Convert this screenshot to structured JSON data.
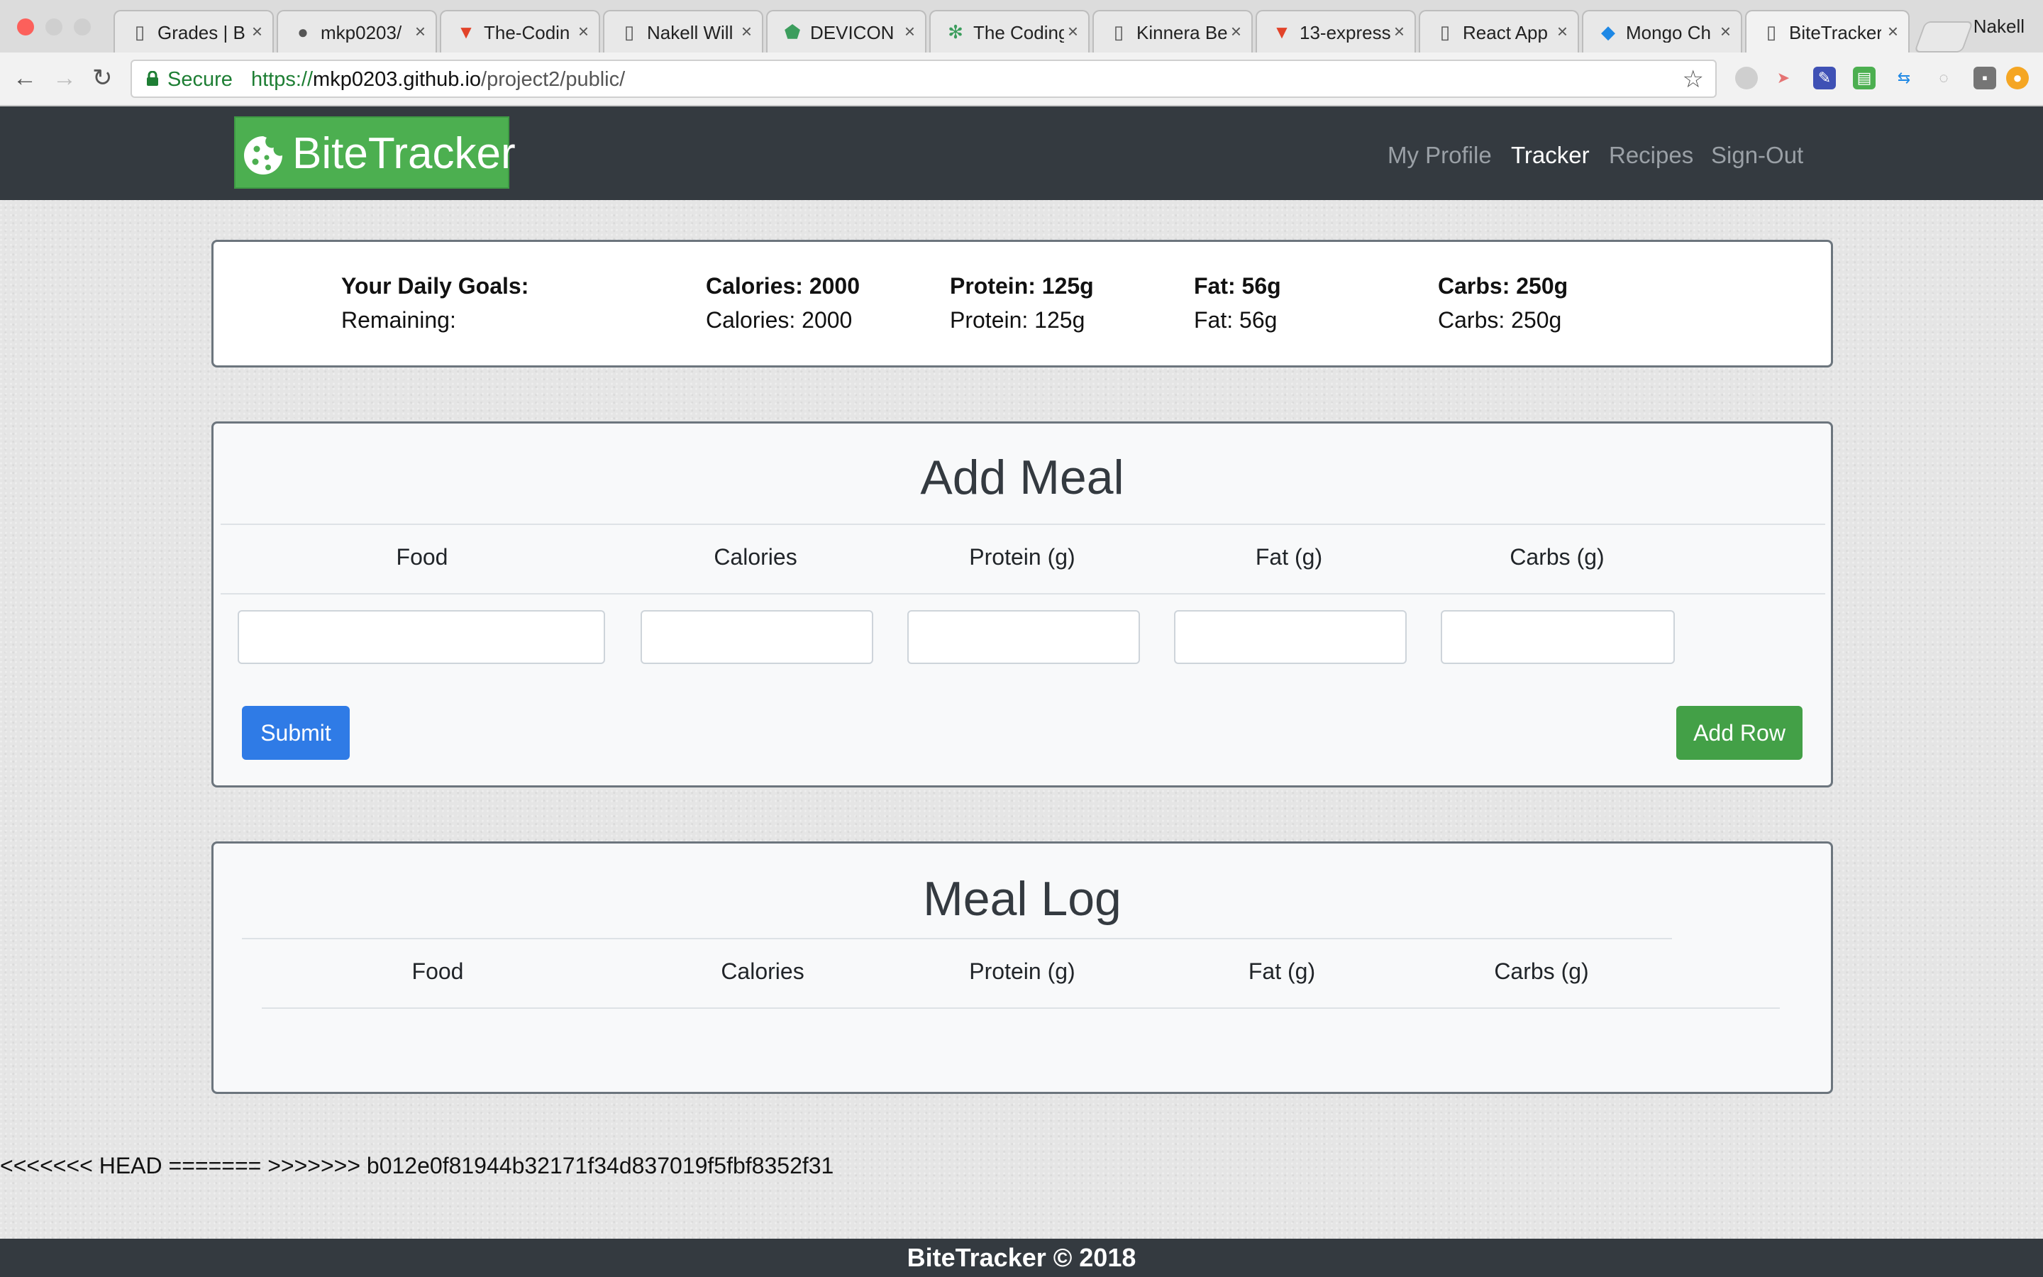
{
  "browser": {
    "tabs": [
      {
        "title": "Grades | B",
        "icon": "page-icon"
      },
      {
        "title": "mkp0203/",
        "icon": "github-icon"
      },
      {
        "title": "The-Codin",
        "icon": "gitlab-icon"
      },
      {
        "title": "Nakell Will",
        "icon": "page-icon"
      },
      {
        "title": "DEVICON",
        "icon": "devicon-icon"
      },
      {
        "title": "The Coding",
        "icon": "plant-icon"
      },
      {
        "title": "Kinnera Be",
        "icon": "page-icon"
      },
      {
        "title": "13-express",
        "icon": "gitlab-icon"
      },
      {
        "title": "React App",
        "icon": "page-icon"
      },
      {
        "title": "Mongo Ch",
        "icon": "mongo-icon"
      },
      {
        "title": "BiteTracker",
        "icon": "page-icon"
      }
    ],
    "profile_name": "Nakell",
    "secure_label": "Secure",
    "url_scheme": "https://",
    "url_host": "mkp0203.github.io",
    "url_path": "/project2/public/"
  },
  "nav": {
    "brand": "BiteTracker",
    "links": [
      "My Profile",
      "Tracker",
      "Recipes",
      "Sign-Out"
    ],
    "active": "Tracker"
  },
  "goals": {
    "daily_label": "Your Daily Goals:",
    "remaining_label": "Remaining:",
    "daily": {
      "calories": "Calories: 2000",
      "protein": "Protein: 125g",
      "fat": "Fat: 56g",
      "carbs": "Carbs: 250g"
    },
    "remaining": {
      "calories": "Calories: 2000",
      "protein": "Protein: 125g",
      "fat": "Fat: 56g",
      "carbs": "Carbs: 250g"
    }
  },
  "add_meal": {
    "title": "Add Meal",
    "columns": [
      "Food",
      "Calories",
      "Protein (g)",
      "Fat (g)",
      "Carbs (g)"
    ],
    "inputs": {
      "food": "",
      "calories": "",
      "protein": "",
      "fat": "",
      "carbs": ""
    },
    "submit_label": "Submit",
    "add_row_label": "Add Row"
  },
  "meal_log": {
    "title": "Meal Log",
    "columns": [
      "Food",
      "Calories",
      "Protein (g)",
      "Fat (g)",
      "Carbs (g)"
    ],
    "rows": []
  },
  "merge_text": "<<<<<<< HEAD ======= >>>>>>> b012e0f81944b32171f34d837019f5fbf8352f31",
  "footer": "BiteTracker © 2018",
  "colors": {
    "navbar": "#343a40",
    "brand": "#4caf50",
    "submit": "#2f7be6",
    "add_row": "#43a047"
  }
}
